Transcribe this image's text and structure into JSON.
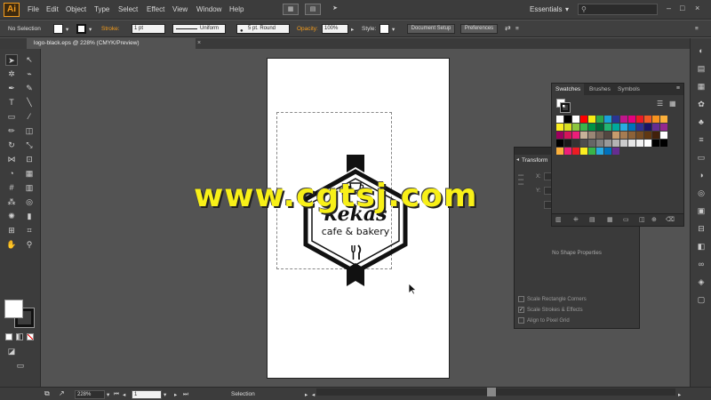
{
  "menubar": {
    "logo": "Ai",
    "items": [
      "File",
      "Edit",
      "Object",
      "Type",
      "Select",
      "Effect",
      "View",
      "Window",
      "Help"
    ],
    "workspace": "Essentials",
    "window_controls": [
      "–",
      "□",
      "×"
    ]
  },
  "control": {
    "selection_state": "No Selection",
    "stroke_label": "Stroke:",
    "stroke_weight": "1 pt",
    "profile": "Uniform",
    "brush": "5 pt. Round",
    "opacity_label": "Opacity:",
    "opacity": "100%",
    "style_label": "Style:",
    "doc_setup": "Document Setup",
    "preferences": "Preferences"
  },
  "document": {
    "tab_title": "logo-black.eps @ 228% (CMYK/Preview)",
    "close": "×"
  },
  "artwork": {
    "brand": "kekas",
    "tagline": "cafe & bakery",
    "watermark": "www.cgtsj.com"
  },
  "swatches_panel": {
    "tabs": [
      "Swatches",
      "Brushes",
      "Symbols"
    ],
    "colors": [
      "#ffffff",
      "#000000",
      "#ffffff",
      "#ff0000",
      "#f7ec14",
      "#2ca84a",
      "#1aa0d8",
      "#2a3592",
      "#c0168c",
      "#e5007e",
      "#ec1c24",
      "#f15a24",
      "#f7931e",
      "#fbb03b",
      "#fcee21",
      "#d9e021",
      "#8cc63f",
      "#39b54a",
      "#009245",
      "#006837",
      "#22b573",
      "#00a99d",
      "#29abe2",
      "#0071bc",
      "#2e3192",
      "#1b1464",
      "#662d91",
      "#93278f",
      "#9e005d",
      "#d4145a",
      "#ed1e79",
      "#c7b299",
      "#998675",
      "#736357",
      "#534741",
      "#c69c6d",
      "#a67c52",
      "#8c6239",
      "#754c24",
      "#603813",
      "#42210b",
      "#ffffff",
      "#000000",
      "#1a1a1a",
      "#333333",
      "#4d4d4d",
      "#666666",
      "#808080",
      "#999999",
      "#b3b3b3",
      "#cccccc",
      "#e6e6e6",
      "#f2f2f2",
      "#ffffff",
      "#000000",
      "#000000",
      "#fbb03b",
      "#ed1e79",
      "#ec1c24",
      "#fcee21",
      "#39b54a",
      "#29abe2",
      "#0071bc",
      "#662d91"
    ]
  },
  "transform_panel": {
    "title": "Transform",
    "x_label": "X:",
    "y_label": "Y:",
    "no_shape": "No Shape Properties",
    "options": [
      {
        "label": "Scale Rectangle Corners",
        "checked": false
      },
      {
        "label": "Scale Strokes & Effects",
        "checked": true
      },
      {
        "label": "Align to Pixel Grid",
        "checked": false
      }
    ]
  },
  "status": {
    "zoom": "228%",
    "artboard_num": "1",
    "tool_name": "Selection"
  }
}
